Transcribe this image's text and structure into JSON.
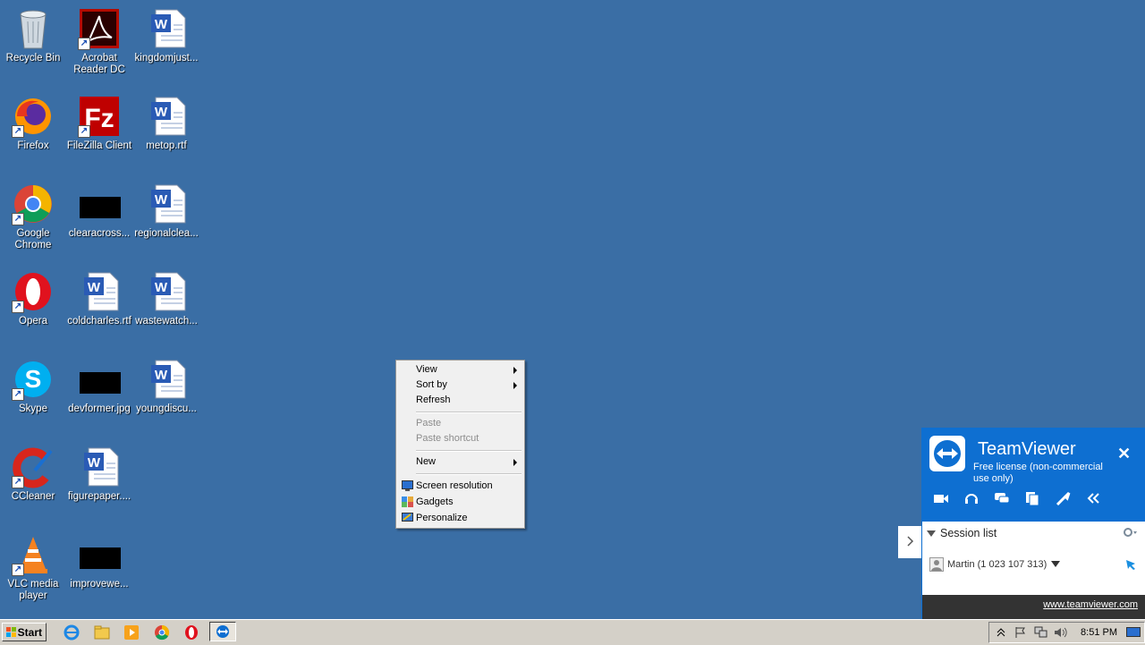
{
  "desktop_icons": [
    {
      "label": "Recycle Bin",
      "icon": "recycle-bin-icon"
    },
    {
      "label": "Acrobat Reader DC",
      "icon": "acrobat-reader-icon"
    },
    {
      "label": "kingdomjust...",
      "icon": "word-document-icon"
    },
    {
      "label": "Firefox",
      "icon": "firefox-icon"
    },
    {
      "label": "FileZilla Client",
      "icon": "filezilla-icon"
    },
    {
      "label": "metop.rtf",
      "icon": "word-document-icon"
    },
    {
      "label": "Google Chrome",
      "icon": "chrome-icon"
    },
    {
      "label": "clearacross...",
      "icon": "black-thumbnail"
    },
    {
      "label": "regionalclea...",
      "icon": "word-document-icon"
    },
    {
      "label": "Opera",
      "icon": "opera-icon"
    },
    {
      "label": "coldcharles.rtf",
      "icon": "word-document-icon"
    },
    {
      "label": "wastewatch...",
      "icon": "word-document-icon"
    },
    {
      "label": "Skype",
      "icon": "skype-icon"
    },
    {
      "label": "devformer.jpg",
      "icon": "black-thumbnail"
    },
    {
      "label": "youngdiscu...",
      "icon": "word-document-icon"
    },
    {
      "label": "CCleaner",
      "icon": "ccleaner-icon"
    },
    {
      "label": "figurepaper....",
      "icon": "word-document-icon"
    },
    {
      "label": "VLC media player",
      "icon": "vlc-icon"
    },
    {
      "label": "improvewe...",
      "icon": "black-thumbnail"
    }
  ],
  "context_menu": {
    "view": "View",
    "sort_by": "Sort by",
    "refresh": "Refresh",
    "paste": "Paste",
    "paste_shortcut": "Paste shortcut",
    "new": "New",
    "screen_resolution": "Screen resolution",
    "gadgets": "Gadgets",
    "personalize": "Personalize"
  },
  "taskbar": {
    "start_label": "Start",
    "clock": "8:51 PM",
    "pinned": [
      "internet-explorer-icon",
      "explorer-folder-icon",
      "media-player-icon",
      "chrome-icon",
      "opera-icon",
      "teamviewer-icon"
    ]
  },
  "teamviewer": {
    "title": "TeamViewer",
    "subtitle": "Free license (non-commercial use only)",
    "session_list": "Session list",
    "partner": "Martin (1 023 107 313)",
    "link": "www.teamviewer.com"
  },
  "colors": {
    "desktop": "#3a6ea5",
    "teamviewer_blue": "#0e6fd1",
    "taskbar": "#d4d0c8"
  }
}
